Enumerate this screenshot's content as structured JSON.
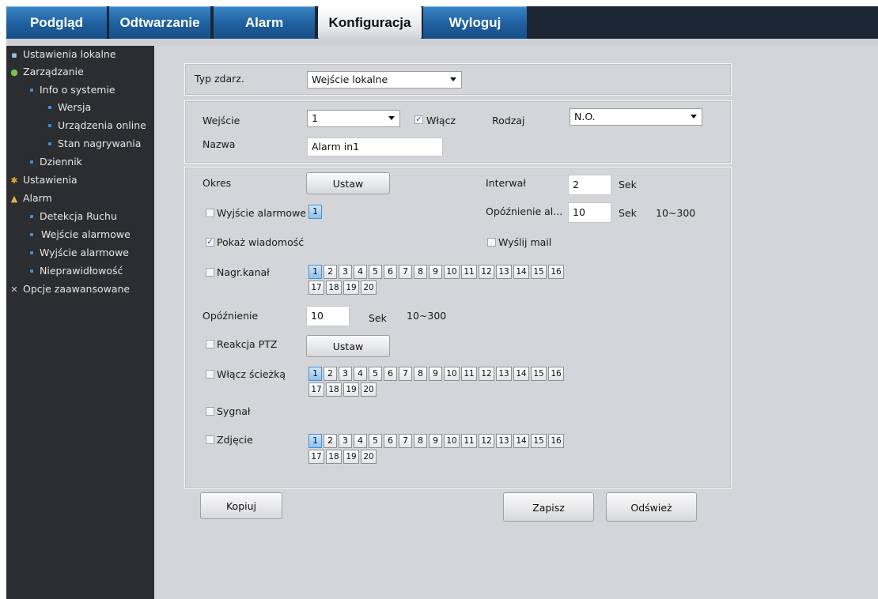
{
  "tabs": [
    {
      "label": "Podgląd",
      "active": false
    },
    {
      "label": "Odtwarzanie",
      "active": false
    },
    {
      "label": "Alarm",
      "active": false
    },
    {
      "label": "Konfiguracja",
      "active": true
    },
    {
      "label": "Wyloguj",
      "active": false
    }
  ],
  "sidebar": {
    "items": [
      {
        "label": "Ustawienia lokalne",
        "icon": "monitor-icon"
      },
      {
        "label": "Zarządzanie",
        "icon": "info-icon"
      },
      {
        "label": "Info o systemie"
      },
      {
        "label": "Wersja"
      },
      {
        "label": "Urządzenia online"
      },
      {
        "label": "Stan nagrywania"
      },
      {
        "label": "Dziennik"
      },
      {
        "label": "Ustawienia",
        "icon": "gear-icon"
      },
      {
        "label": "Alarm",
        "icon": "bell-icon"
      },
      {
        "label": "Detekcja Ruchu"
      },
      {
        "label": "Wejście alarmowe",
        "selected": true
      },
      {
        "label": "Wyjście alarmowe"
      },
      {
        "label": "Nieprawidłowość"
      },
      {
        "label": "Opcje zaawansowane",
        "icon": "tools-icon"
      }
    ]
  },
  "event_type": {
    "label": "Typ zdarz.",
    "value": "Wejście lokalne"
  },
  "input": {
    "label": "Wejście",
    "value": "1",
    "enable_label": "Włącz",
    "enable_checked": true,
    "type_label": "Rodzaj",
    "type_value": "N.O."
  },
  "name": {
    "label": "Nazwa",
    "value": "Alarm in1"
  },
  "period": {
    "label": "Okres",
    "button": "Ustaw"
  },
  "interval": {
    "label": "Interwał",
    "value": "2",
    "unit": "Sek"
  },
  "alarm_out": {
    "label": "Wyjście alarmowe",
    "checked": false,
    "channels": [
      "1"
    ]
  },
  "alarm_delay": {
    "label": "Opóźnienie al...",
    "value": "10",
    "unit": "Sek",
    "range": "10~300"
  },
  "show_message": {
    "label": "Pokaż wiadomość",
    "checked": true
  },
  "send_mail": {
    "label": "Wyślij mail",
    "checked": false
  },
  "record_channel": {
    "label": "Nagr.kanał",
    "checked": false,
    "channels": [
      "1",
      "2",
      "3",
      "4",
      "5",
      "6",
      "7",
      "8",
      "9",
      "10",
      "11",
      "12",
      "13",
      "14",
      "15",
      "16",
      "17",
      "18",
      "19",
      "20"
    ]
  },
  "delay": {
    "label": "Opóźnienie",
    "value": "10",
    "unit": "Sek",
    "range": "10~300"
  },
  "ptz": {
    "label": "Reakcja PTZ",
    "checked": false,
    "button": "Ustaw"
  },
  "tour": {
    "label": "Włącz ścieżką",
    "checked": false,
    "channels": [
      "1",
      "2",
      "3",
      "4",
      "5",
      "6",
      "7",
      "8",
      "9",
      "10",
      "11",
      "12",
      "13",
      "14",
      "15",
      "16",
      "17",
      "18",
      "19",
      "20"
    ]
  },
  "signal": {
    "label": "Sygnał",
    "checked": false
  },
  "snapshot": {
    "label": "Zdjęcie",
    "checked": false,
    "channels": [
      "1",
      "2",
      "3",
      "4",
      "5",
      "6",
      "7",
      "8",
      "9",
      "10",
      "11",
      "12",
      "13",
      "14",
      "15",
      "16",
      "17",
      "18",
      "19",
      "20"
    ]
  },
  "buttons": {
    "copy": "Kopiuj",
    "save": "Zapisz",
    "refresh": "Odśwież"
  },
  "colors": {
    "tab_blue": "#1f5f9e",
    "selected_nav": "#2f6fc2",
    "sidebar_bg": "#2b2d30",
    "content_bg": "#d4d5d8"
  }
}
